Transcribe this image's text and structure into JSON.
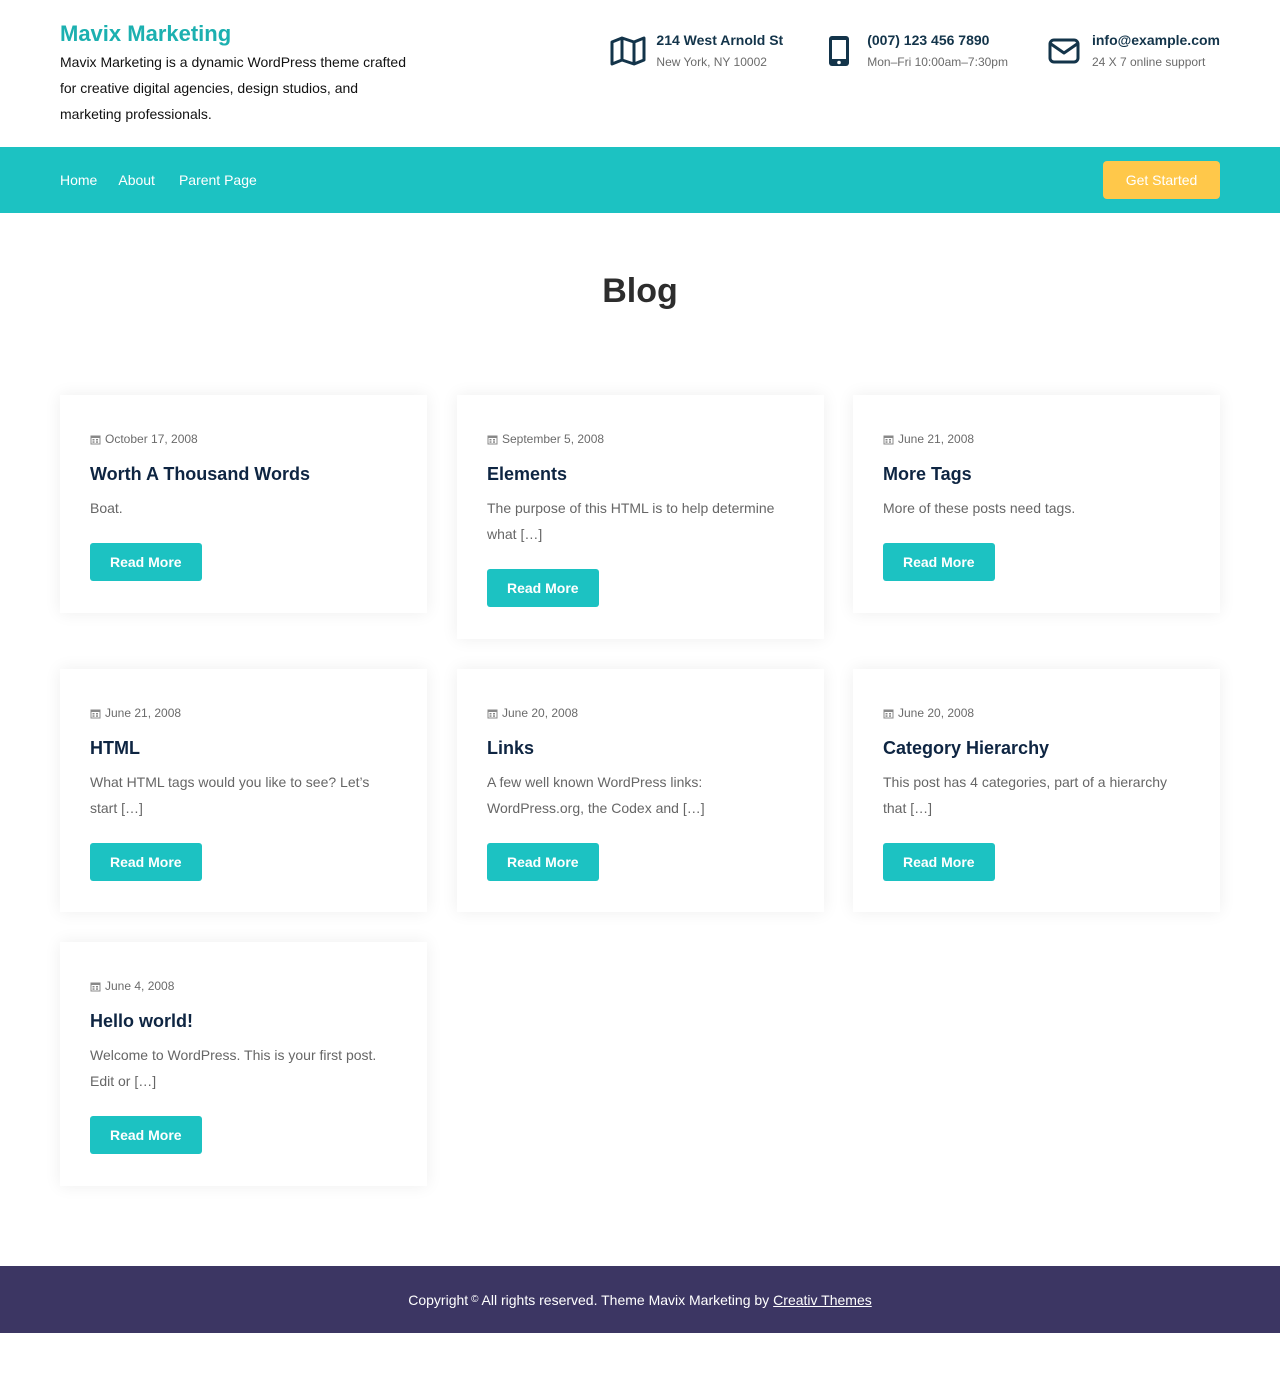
{
  "header": {
    "site_title": "Mavix Marketing",
    "site_description": "Mavix Marketing is a dynamic WordPress theme crafted for creative digital agencies, design studios, and marketing professionals.",
    "contacts": [
      {
        "icon": "map-icon",
        "main": "214 West Arnold St",
        "sub": "New York, NY 10002"
      },
      {
        "icon": "phone-icon",
        "main": "(007) 123 456 7890",
        "sub": "Mon–Fri 10:00am–7:30pm"
      },
      {
        "icon": "envelope-icon",
        "main": "info@example.com",
        "sub": "24 X 7 online support"
      }
    ]
  },
  "nav": {
    "items": [
      "Home",
      "About",
      "Parent Page"
    ],
    "cta_label": "Get Started"
  },
  "page": {
    "title": "Blog"
  },
  "posts": [
    {
      "date": "October 17, 2008",
      "title": "Worth A Thousand Words",
      "excerpt": "Boat.",
      "button": "Read More"
    },
    {
      "date": "September 5, 2008",
      "title": "Elements",
      "excerpt": "The purpose of this HTML is to help determine what […]",
      "button": "Read More"
    },
    {
      "date": "June 21, 2008",
      "title": "More Tags",
      "excerpt": "More of these posts need tags.",
      "button": "Read More"
    },
    {
      "date": "June 21, 2008",
      "title": "HTML",
      "excerpt": "What HTML tags would you like to see? Let’s start […]",
      "button": "Read More"
    },
    {
      "date": "June 20, 2008",
      "title": "Links",
      "excerpt": "A few well known WordPress links: WordPress.org, the Codex and […]",
      "button": "Read More"
    },
    {
      "date": "June 20, 2008",
      "title": "Category Hierarchy",
      "excerpt": "This post has 4 categories, part of a hierarchy that […]",
      "button": "Read More"
    },
    {
      "date": "June 4, 2008",
      "title": "Hello world!",
      "excerpt": "Welcome to WordPress. This is your first post. Edit or […]",
      "button": "Read More"
    }
  ],
  "footer": {
    "copyright": "Copyright",
    "copy_symbol": "©",
    "text": "All rights reserved. Theme Mavix Marketing by",
    "link": "Creativ Themes"
  },
  "colors": {
    "accent": "#1cc2c2",
    "brand_title": "#1cb0b0",
    "cta": "#ffc84a",
    "footer": "#3c3663",
    "heading": "#0e2542"
  }
}
